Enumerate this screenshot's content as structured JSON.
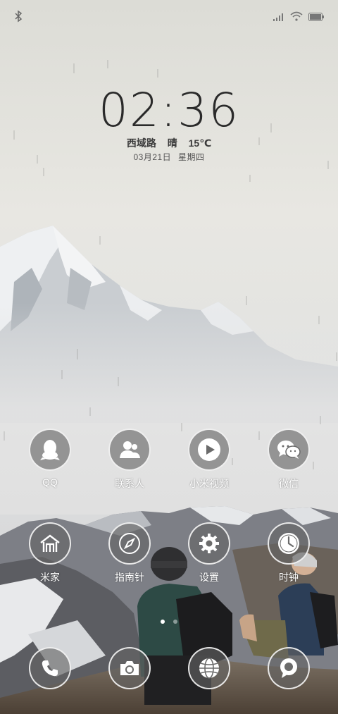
{
  "clock": {
    "time": "02:36"
  },
  "weather": {
    "location": "西域路",
    "condition": "晴",
    "temperature": "15℃"
  },
  "date": {
    "date": "03月21日",
    "weekday": "星期四"
  },
  "apps_row1": [
    {
      "label": "QQ",
      "icon": "qq-penguin-icon"
    },
    {
      "label": "联系人",
      "icon": "contacts-icon"
    },
    {
      "label": "小米视频",
      "icon": "play-icon"
    },
    {
      "label": "微信",
      "icon": "wechat-icon"
    }
  ],
  "apps_row2": [
    {
      "label": "米家",
      "icon": "mi-home-icon"
    },
    {
      "label": "指南针",
      "icon": "compass-icon"
    },
    {
      "label": "设置",
      "icon": "gear-icon"
    },
    {
      "label": "时钟",
      "icon": "clock-icon"
    }
  ],
  "dock": [
    {
      "icon": "phone-icon"
    },
    {
      "icon": "camera-icon"
    },
    {
      "icon": "browser-globe-icon"
    },
    {
      "icon": "messages-icon"
    }
  ],
  "page_indicator": {
    "pages": 2,
    "current": 1
  },
  "colors": {
    "icon_bg": "#646464",
    "text": "#ffffff",
    "clock": "#2a2a2a"
  }
}
